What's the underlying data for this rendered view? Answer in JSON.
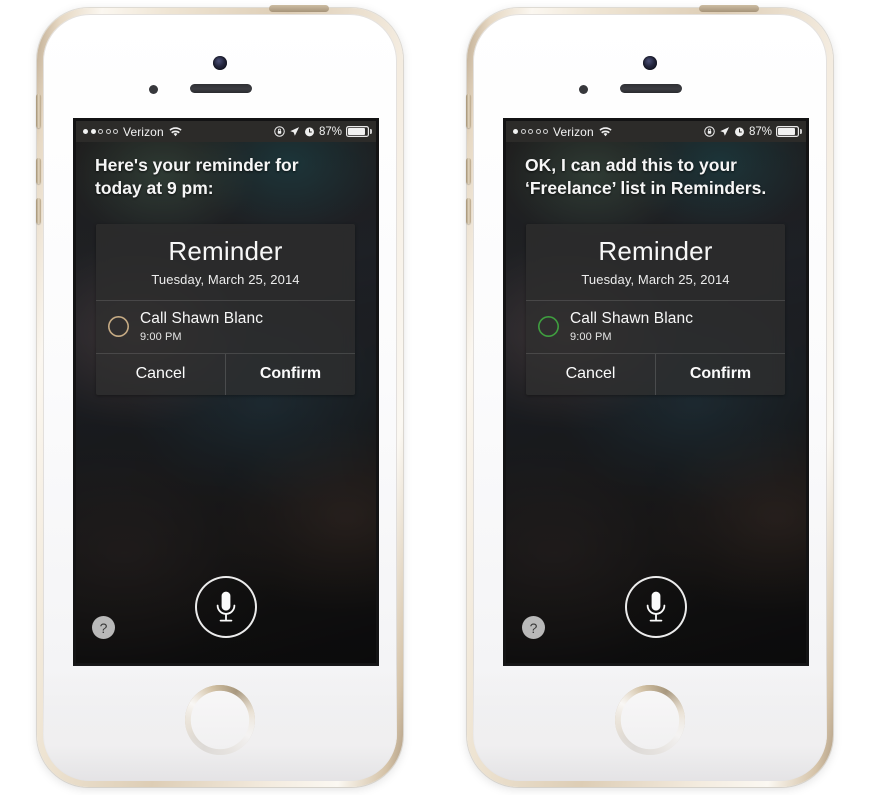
{
  "phones": [
    {
      "id": "left",
      "status_bar": {
        "signal_dots_filled": 2,
        "signal_dots_total": 5,
        "carrier": "Verizon",
        "wifi_icon": "wifi-icon",
        "rotation_lock_icon": "rotation-lock-icon",
        "location_icon": "location-arrow-icon",
        "alarm_icon": "alarm-clock-icon",
        "battery_percent": "87%",
        "battery_level": 87
      },
      "siri_response": "Here's your reminder for\ntoday at 9 pm:",
      "card": {
        "title": "Reminder",
        "date": "Tuesday, March 25, 2014",
        "item": {
          "title": "Call Shawn Blanc",
          "time": "9:00 PM",
          "circle_color": "#c6ab84"
        },
        "cancel_label": "Cancel",
        "confirm_label": "Confirm"
      },
      "mic_icon": "microphone-icon",
      "help_label": "?"
    },
    {
      "id": "right",
      "status_bar": {
        "signal_dots_filled": 1,
        "signal_dots_total": 5,
        "carrier": "Verizon",
        "wifi_icon": "wifi-icon",
        "rotation_lock_icon": "rotation-lock-icon",
        "location_icon": "location-arrow-icon",
        "alarm_icon": "alarm-clock-icon",
        "battery_percent": "87%",
        "battery_level": 87
      },
      "siri_response": "OK, I can add this to your\n‘Freelance’ list in Reminders.",
      "card": {
        "title": "Reminder",
        "date": "Tuesday, March 25, 2014",
        "item": {
          "title": "Call Shawn Blanc",
          "time": "9:00 PM",
          "circle_color": "#3f9e3f"
        },
        "cancel_label": "Cancel",
        "confirm_label": "Confirm"
      },
      "mic_icon": "microphone-icon",
      "help_label": "?"
    }
  ],
  "device": {
    "model_finish": "gold",
    "front_color": "#ffffff",
    "home_button": "home-button",
    "camera": "front-camera",
    "speaker": "earpiece-speaker",
    "sensor": "proximity-sensor",
    "buttons": [
      "silent-switch",
      "volume-up",
      "volume-down",
      "power-button"
    ]
  }
}
